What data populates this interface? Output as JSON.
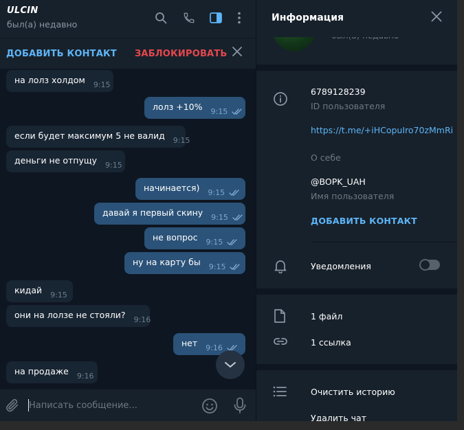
{
  "chat": {
    "name": "ULCIN",
    "status": "был(а) недавно",
    "action_bar": {
      "add_contact": "ДОБАВИТЬ КОНТАКТ",
      "block": "ЗАБЛОКИРОВАТЬ"
    },
    "messages": [
      {
        "dir": "in",
        "text": "на лолз холдом",
        "time": "9:15"
      },
      {
        "dir": "out",
        "text": "лолз +10%",
        "time": "9:15"
      },
      {
        "dir": "in",
        "text": "если будет максимум 5 не валид",
        "time": "9:15"
      },
      {
        "dir": "in",
        "text": "деньги не отпущу",
        "time": "9:15"
      },
      {
        "dir": "out",
        "text": "начинается)",
        "time": "9:15"
      },
      {
        "dir": "out",
        "text": "давай я первый скину",
        "time": "9:15"
      },
      {
        "dir": "out",
        "text": "не вопрос",
        "time": "9:15"
      },
      {
        "dir": "out",
        "text": "ну на карту бы",
        "time": "9:15"
      },
      {
        "dir": "in",
        "text": "кидай",
        "time": "9:15"
      },
      {
        "dir": "in",
        "text": "они на лолзе не стояли?",
        "time": "9:16"
      },
      {
        "dir": "out",
        "text": "нет",
        "time": "9:16"
      },
      {
        "dir": "in",
        "text": "на продаже",
        "time": "9:16"
      }
    ],
    "composer": {
      "placeholder": "Написать сообщение..."
    }
  },
  "info": {
    "title": "Информация",
    "avatar_status": "был(а) недавно",
    "phone": "6789128239",
    "phone_label": "ID пользователя",
    "bio": "https://t.me/+iHCopuIro70zMmRi",
    "bio_label": "О себе",
    "username": "@BOPK_UAH",
    "username_label": "Имя пользователя",
    "add_contact": "ДОБАВИТЬ КОНТАКТ",
    "notifications_label": "Уведомления",
    "notifications_on": false,
    "files": "1 файл",
    "links": "1 ссылка",
    "clear_history": "Очистить историю",
    "delete_chat": "Удалить чат"
  },
  "colors": {
    "accent": "#5eb5f7",
    "danger": "#e5474d",
    "outgoing_bubble": "#2b5278",
    "incoming_bubble": "#182533"
  },
  "icons": {
    "header": [
      "search-icon",
      "phone-icon",
      "sidebar-panel-icon",
      "more-vertical-icon"
    ],
    "composer": [
      "paperclip-icon",
      "emoji-icon",
      "microphone-icon"
    ],
    "info": [
      "info-icon",
      "bell-icon",
      "file-icon",
      "link-icon",
      "list-icon",
      "close-icon"
    ]
  }
}
